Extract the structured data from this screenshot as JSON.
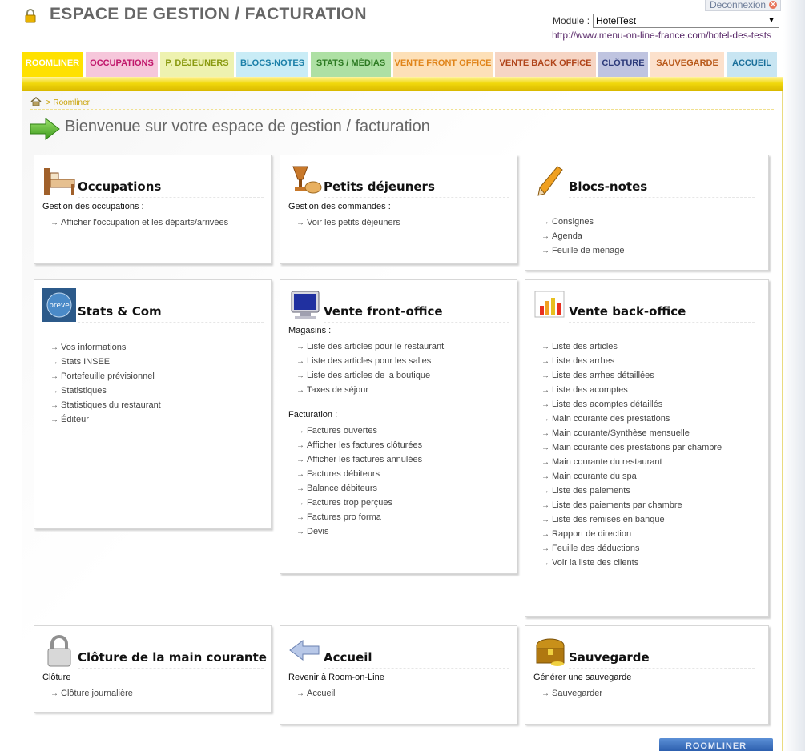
{
  "header": {
    "title": "ESPACE DE GESTION / FACTURATION",
    "logout_label": "Deconnexion",
    "module_label": "Module :",
    "module_value": "HotelTest",
    "site_url": "http://www.menu-on-line-france.com/hotel-des-tests"
  },
  "tabs": [
    {
      "label": "ROOMLINER",
      "bg": "#ffe100",
      "color": "#ffffff",
      "active": true
    },
    {
      "label": "OCCUPATIONS",
      "bg": "#f6c7db",
      "color": "#c0166b"
    },
    {
      "label": "P. DÉJEUNERS",
      "bg": "#eef2b0",
      "color": "#8a9a10"
    },
    {
      "label": "BLOCS-NOTES",
      "bg": "#c9ecf6",
      "color": "#1a7fa8"
    },
    {
      "label": "STATS / MÉDIAS",
      "bg": "#aee0a4",
      "color": "#2d7a22"
    },
    {
      "label": "VENTE FRONT OFFICE",
      "bg": "#fde0b8",
      "color": "#e0841a"
    },
    {
      "label": "VENTE BACK OFFICE",
      "bg": "#f6d5c4",
      "color": "#b0441a"
    },
    {
      "label": "CLÔTURE",
      "bg": "#bfc4e0",
      "color": "#2c3a7a"
    },
    {
      "label": "SAUVEGARDE",
      "bg": "#fce1cc",
      "color": "#b8591a"
    },
    {
      "label": "ACCUEIL",
      "bg": "#c8e5f2",
      "color": "#1a6f9a"
    }
  ],
  "breadcrumb": "> Roomliner",
  "welcome": "Bienvenue sur votre espace de gestion / facturation",
  "panels": {
    "occupations": {
      "title": "Occupations",
      "sections": [
        {
          "heading": "Gestion des occupations :",
          "links": [
            "Afficher l'occupation et les départs/arrivées"
          ]
        }
      ]
    },
    "petits_dejeuners": {
      "title": "Petits déjeuners",
      "sections": [
        {
          "heading": "Gestion des commandes :",
          "links": [
            "Voir les petits déjeuners"
          ]
        }
      ]
    },
    "blocs_notes": {
      "title": "Blocs-notes",
      "sections": [
        {
          "heading": "",
          "links": [
            "Consignes",
            "Agenda",
            "Feuille de ménage"
          ]
        }
      ]
    },
    "stats": {
      "title": "Stats & Com",
      "icon_text": "breve",
      "sections": [
        {
          "heading": "",
          "links": [
            "Vos informations",
            "Stats INSEE",
            "Portefeuille prévisionnel",
            "Statistiques",
            "Statistiques du restaurant",
            "Éditeur"
          ]
        }
      ]
    },
    "vente_front": {
      "title": "Vente front-office",
      "sections": [
        {
          "heading": "Magasins :",
          "links": [
            "Liste des articles pour le restaurant",
            "Liste des articles pour les salles",
            "Liste des articles de la boutique",
            "Taxes de séjour"
          ]
        },
        {
          "heading": "Facturation :",
          "links": [
            "Factures ouvertes",
            "Afficher les factures clôturées",
            "Afficher les factures annulées",
            "Factures débiteurs",
            "Balance débiteurs",
            "Factures trop perçues",
            "Factures pro forma",
            "Devis"
          ]
        }
      ]
    },
    "vente_back": {
      "title": "Vente back-office",
      "sections": [
        {
          "heading": "",
          "links": [
            "Liste des articles",
            "Liste des arrhes",
            "Liste des arrhes détaillées",
            "Liste des acomptes",
            "Liste des acomptes détaillés",
            "Main courante des prestations",
            "Main courante/Synthèse mensuelle",
            "Main courante des prestations par chambre",
            "Main courante du restaurant",
            "Main courante du spa",
            "Liste des paiements",
            "Liste des paiements par chambre",
            "Liste des remises en banque",
            "Rapport de direction",
            "Feuille des déductions",
            "Voir la liste des clients"
          ]
        }
      ]
    },
    "cloture": {
      "title": "Clôture de la main courante",
      "sections": [
        {
          "heading": "Clôture",
          "links": [
            "Clôture journalière"
          ]
        }
      ]
    },
    "accueil": {
      "title": "Accueil",
      "sections": [
        {
          "heading": "Revenir à Room-on-Line",
          "links": [
            "Accueil"
          ]
        }
      ]
    },
    "sauvegarde": {
      "title": "Sauvegarde",
      "sections": [
        {
          "heading": "Générer une sauvegarde",
          "links": [
            "Sauvegarder"
          ]
        }
      ]
    }
  },
  "footer_logo": "ROOMLINER"
}
